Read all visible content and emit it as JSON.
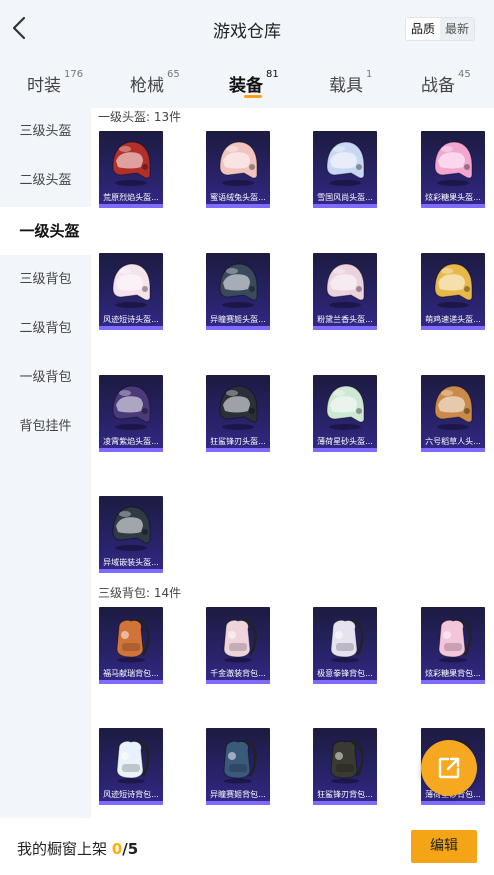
{
  "header": {
    "title": "游戏仓库",
    "sort_options": [
      "品质",
      "最新"
    ]
  },
  "tabs": [
    {
      "label": "时装",
      "count": "176"
    },
    {
      "label": "枪械",
      "count": "65"
    },
    {
      "label": "装备",
      "count": "81"
    },
    {
      "label": "载具",
      "count": "1"
    },
    {
      "label": "战备",
      "count": "45"
    }
  ],
  "active_tab": "装备",
  "sidebar": [
    {
      "label": "三级头盔"
    },
    {
      "label": "二级头盔"
    },
    {
      "label": "一级头盔"
    },
    {
      "label": "三级背包"
    },
    {
      "label": "二级背包"
    },
    {
      "label": "一级背包"
    },
    {
      "label": "背包挂件"
    }
  ],
  "active_sidebar": "一级头盔",
  "sections": [
    {
      "title": "一级头盔: 13件",
      "items": [
        {
          "name": "荒原烈焰头盔...",
          "icon": "helmet-icon",
          "color": "#b3302a"
        },
        {
          "name": "蜜语绒兔头盔...",
          "icon": "helmet-icon",
          "color": "#f2c4c0"
        },
        {
          "name": "雪国风尚头盔...",
          "icon": "helmet-icon",
          "color": "#c9d8f2"
        },
        {
          "name": "炫彩糖果头盔...",
          "icon": "helmet-icon",
          "color": "#f3a7d0"
        },
        {
          "name": "风迹短诗头盔...",
          "icon": "helmet-icon",
          "color": "#f4e3ea"
        },
        {
          "name": "异瞳赛姬头盔...",
          "icon": "helmet-icon",
          "color": "#3a4a5c"
        },
        {
          "name": "粉黛兰香头盔...",
          "icon": "helmet-icon",
          "color": "#ecd2dd"
        },
        {
          "name": "萌鸡速递头盔...",
          "icon": "helmet-icon",
          "color": "#e8b84a"
        },
        {
          "name": "凌霄紫焰头盔...",
          "icon": "helmet-icon",
          "color": "#4a3a78"
        },
        {
          "name": "狂鲨锋刃头盔...",
          "icon": "helmet-icon",
          "color": "#2b2f3a"
        },
        {
          "name": "薄荷星砂头盔...",
          "icon": "helmet-icon",
          "color": "#cfe8d4"
        },
        {
          "name": "六号稻草人头...",
          "icon": "helmet-icon",
          "color": "#c98a4a"
        },
        {
          "name": "异域嵌装头盔...",
          "icon": "helmet-icon",
          "color": "#2f3a44"
        }
      ]
    },
    {
      "title": "三级背包: 14件",
      "items": [
        {
          "name": "福马献瑞背包...",
          "icon": "backpack-icon",
          "color": "#d2743a"
        },
        {
          "name": "千金澈装背包...",
          "icon": "backpack-icon",
          "color": "#f0d4dc"
        },
        {
          "name": "极意拳锋背包...",
          "icon": "backpack-icon",
          "color": "#e6e2f0"
        },
        {
          "name": "炫彩糖果背包...",
          "icon": "backpack-icon",
          "color": "#f4c6dc"
        },
        {
          "name": "风迹短诗背包...",
          "icon": "backpack-icon",
          "color": "#e8f2f8"
        },
        {
          "name": "异瞳赛姬背包...",
          "icon": "backpack-icon",
          "color": "#3a5a7a"
        },
        {
          "name": "狂鲨锋刃背包...",
          "icon": "backpack-icon",
          "color": "#3a3a30"
        },
        {
          "name": "薄荷星砂背包...",
          "icon": "backpack-icon",
          "color": "#cfe8d4"
        }
      ]
    }
  ],
  "footer": {
    "label": "我的橱窗上架",
    "current": "0",
    "max": "/5",
    "edit_label": "编辑"
  },
  "colors": {
    "accent": "#f4a516",
    "card_bg": "#2b2470",
    "card_bar": "#7d6cff"
  }
}
